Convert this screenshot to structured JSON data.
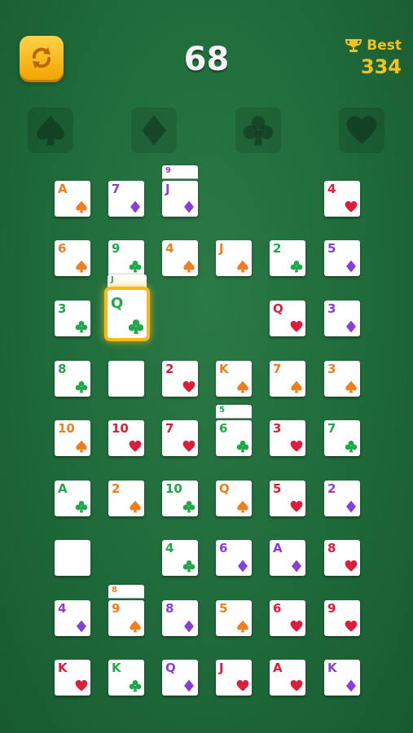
{
  "header": {
    "score": "68",
    "best_label": "Best",
    "best_value": "334"
  },
  "colors": {
    "spade": "#f07d1e",
    "club": "#21a84a",
    "diamond": "#8a3ed9",
    "heart": "#dc1d3c",
    "highlight": "#f7b91b"
  },
  "foundations": [
    {
      "suit": "spade",
      "icon": "spade-icon"
    },
    {
      "suit": "diamond",
      "icon": "diamond-icon"
    },
    {
      "suit": "club",
      "icon": "club-icon"
    },
    {
      "suit": "heart",
      "icon": "heart-icon"
    }
  ],
  "cards": [
    {
      "rank": "A",
      "suit": "spade"
    },
    {
      "rank": "7",
      "suit": "diamond"
    },
    {
      "rank": "J",
      "suit": "diamond",
      "peek": "9"
    },
    {
      "rank": "4",
      "suit": "heart"
    },
    {
      "rank": "6",
      "suit": "spade"
    },
    {
      "rank": "9",
      "suit": "club"
    },
    {
      "rank": "4",
      "suit": "spade"
    },
    {
      "rank": "J",
      "suit": "spade"
    },
    {
      "rank": "2",
      "suit": "club"
    },
    {
      "rank": "5",
      "suit": "diamond"
    },
    {
      "rank": "3",
      "suit": "club"
    },
    {
      "rank": "Q",
      "suit": "club",
      "peek": "J",
      "selected": true
    },
    {
      "rank": "Q",
      "suit": "heart"
    },
    {
      "rank": "3",
      "suit": "diamond"
    },
    {
      "rank": "8",
      "suit": "club"
    },
    {
      "rank": "",
      "suit": ""
    },
    {
      "rank": "2",
      "suit": "heart"
    },
    {
      "rank": "K",
      "suit": "spade"
    },
    {
      "rank": "7",
      "suit": "spade"
    },
    {
      "rank": "3",
      "suit": "spade"
    },
    {
      "rank": "10",
      "suit": "spade"
    },
    {
      "rank": "10",
      "suit": "heart"
    },
    {
      "rank": "7",
      "suit": "heart"
    },
    {
      "rank": "6",
      "suit": "club",
      "peek": "5"
    },
    {
      "rank": "3",
      "suit": "heart"
    },
    {
      "rank": "7",
      "suit": "club"
    },
    {
      "rank": "A",
      "suit": "club"
    },
    {
      "rank": "2",
      "suit": "spade"
    },
    {
      "rank": "10",
      "suit": "club"
    },
    {
      "rank": "Q",
      "suit": "spade"
    },
    {
      "rank": "5",
      "suit": "heart"
    },
    {
      "rank": "2",
      "suit": "diamond"
    },
    {
      "rank": "",
      "suit": ""
    },
    {
      "rank": "4",
      "suit": "club"
    },
    {
      "rank": "6",
      "suit": "diamond"
    },
    {
      "rank": "A",
      "suit": "diamond"
    },
    {
      "rank": "8",
      "suit": "heart"
    },
    {
      "rank": "4",
      "suit": "diamond"
    },
    {
      "rank": "9",
      "suit": "spade",
      "peek": "8"
    },
    {
      "rank": "8",
      "suit": "diamond"
    },
    {
      "rank": "5",
      "suit": "spade"
    },
    {
      "rank": "6",
      "suit": "heart"
    },
    {
      "rank": "9",
      "suit": "heart"
    },
    {
      "rank": "K",
      "suit": "heart"
    },
    {
      "rank": "K",
      "suit": "club"
    },
    {
      "rank": "Q",
      "suit": "diamond"
    },
    {
      "rank": "J",
      "suit": "heart"
    },
    {
      "rank": "A",
      "suit": "heart"
    },
    {
      "rank": "K",
      "suit": "diamond"
    }
  ]
}
